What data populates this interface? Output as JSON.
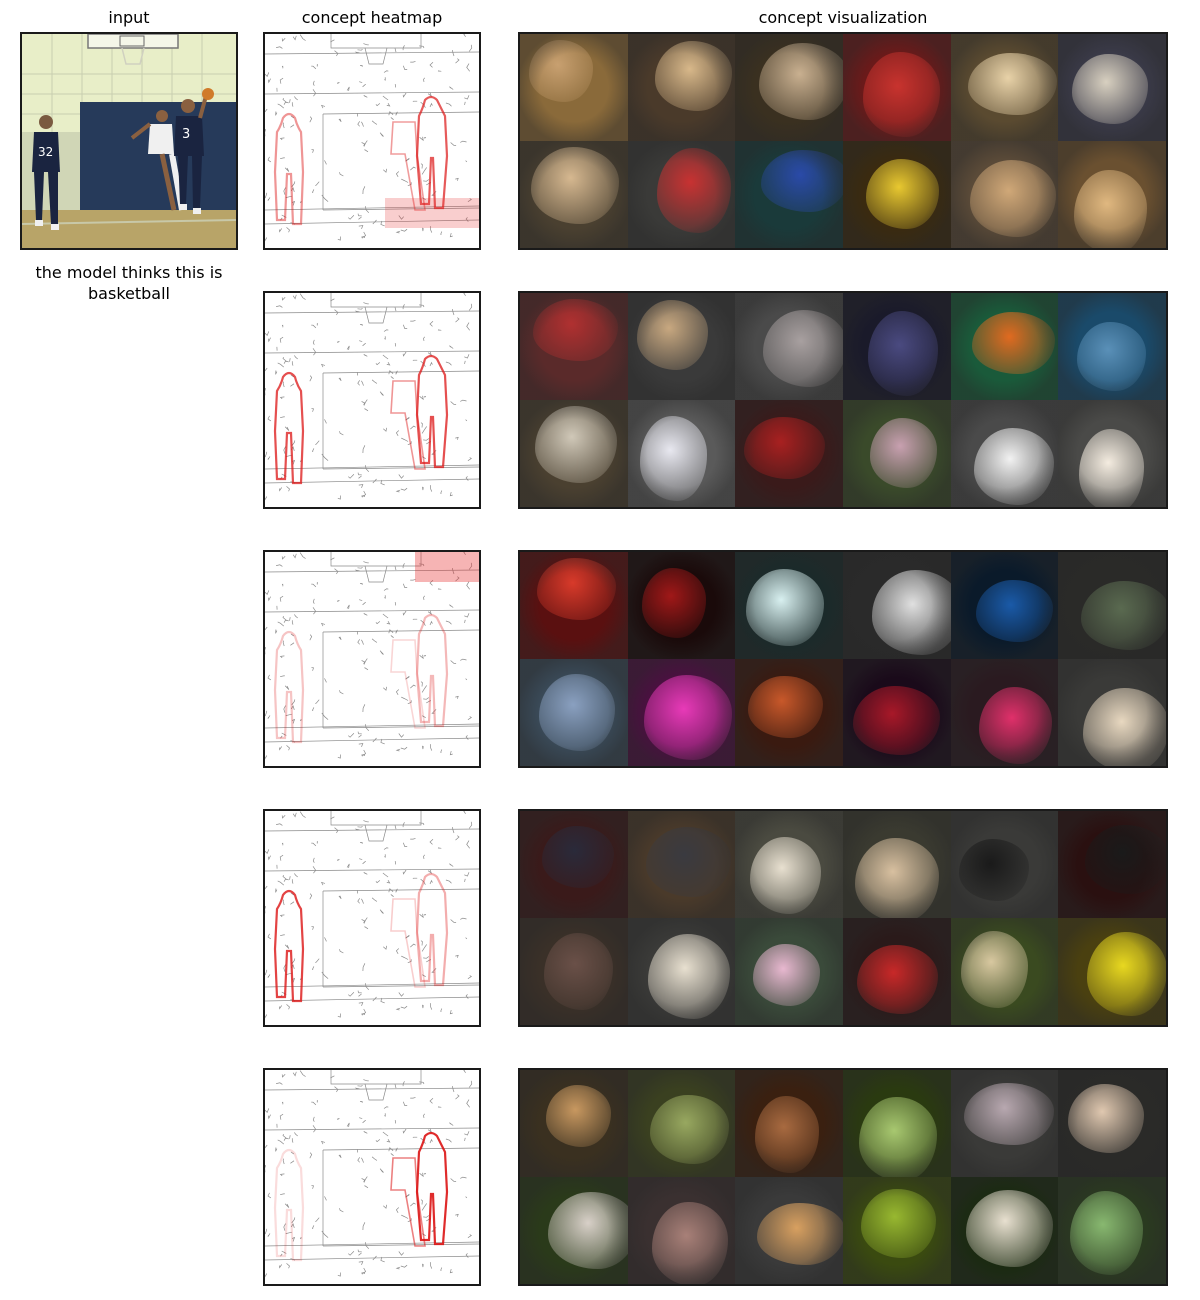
{
  "headers": {
    "input": "input",
    "heatmap": "concept heatmap",
    "visualization": "concept visualization"
  },
  "caption": "the model thinks this is basketball",
  "input_image": {
    "jersey_numbers": [
      "32",
      "3"
    ]
  },
  "concepts": [
    {
      "heatmap_focus": "both players and floor edge",
      "tiles": [
        {
          "bg": "#8a6a3a",
          "fg": "#c8a070"
        },
        {
          "bg": "#4a3a2a",
          "fg": "#d8b88a"
        },
        {
          "bg": "#3a3020",
          "fg": "#c9b090"
        },
        {
          "bg": "#6a1a1a",
          "fg": "#c8332e"
        },
        {
          "bg": "#5a4a30",
          "fg": "#e8d2a8"
        },
        {
          "bg": "#3a3a48",
          "fg": "#d8d0c0"
        },
        {
          "bg": "#4a4030",
          "fg": "#d6b890"
        },
        {
          "bg": "#3a3a38",
          "fg": "#c83232"
        },
        {
          "bg": "#1a3a3a",
          "fg": "#2a4aa8"
        },
        {
          "bg": "#3a2a10",
          "fg": "#e8c830"
        },
        {
          "bg": "#5a4a38",
          "fg": "#d0a878"
        },
        {
          "bg": "#6a5030",
          "fg": "#e0b880"
        }
      ]
    },
    {
      "heatmap_focus": "left player and right player",
      "tiles": [
        {
          "bg": "#5a2a2a",
          "fg": "#b03030"
        },
        {
          "bg": "#3a3a3a",
          "fg": "#c8a880"
        },
        {
          "bg": "#4a4a4a",
          "fg": "#a8a0a0"
        },
        {
          "bg": "#1a1a2a",
          "fg": "#4a4a80"
        },
        {
          "bg": "#1a5a3a",
          "fg": "#e06a20"
        },
        {
          "bg": "#1a4a6a",
          "fg": "#5a90b8"
        },
        {
          "bg": "#4a4030",
          "fg": "#d0c8b8"
        },
        {
          "bg": "#5a5a5a",
          "fg": "#e8e8f0"
        },
        {
          "bg": "#3a1a1a",
          "fg": "#a82020"
        },
        {
          "bg": "#3a4a2a",
          "fg": "#c8a0b0"
        },
        {
          "bg": "#4a4a4a",
          "fg": "#f2f2f2"
        },
        {
          "bg": "#4a4a48",
          "fg": "#f4ece0"
        }
      ]
    },
    {
      "heatmap_focus": "top-right corner",
      "tiles": [
        {
          "bg": "#5a1010",
          "fg": "#d83a2a"
        },
        {
          "bg": "#1a0a0a",
          "fg": "#a01818"
        },
        {
          "bg": "#1a2a2a",
          "fg": "#d8f0f0"
        },
        {
          "bg": "#2a2a2a",
          "fg": "#e0e0e0"
        },
        {
          "bg": "#0a1a2a",
          "fg": "#1a5aa8"
        },
        {
          "bg": "#2a2a28",
          "fg": "#5a6a50"
        },
        {
          "bg": "#3a4a58",
          "fg": "#8aa0c0"
        },
        {
          "bg": "#4a1040",
          "fg": "#e83ab8"
        },
        {
          "bg": "#3a1a10",
          "fg": "#c8582a"
        },
        {
          "bg": "#1a0a1a",
          "fg": "#a81828"
        },
        {
          "bg": "#2a1a20",
          "fg": "#e0306a"
        },
        {
          "bg": "#3a3a38",
          "fg": "#e8d8c0"
        }
      ]
    },
    {
      "heatmap_focus": "left player head",
      "tiles": [
        {
          "bg": "#3a1a1a",
          "fg": "#2a2a3a"
        },
        {
          "bg": "#4a3a2a",
          "fg": "#3a3a40"
        },
        {
          "bg": "#4a4a40",
          "fg": "#e8e0d0"
        },
        {
          "bg": "#3a3a30",
          "fg": "#d8c0a0"
        },
        {
          "bg": "#3a3a38",
          "fg": "#1a1a1a"
        },
        {
          "bg": "#2a1010",
          "fg": "#1a1a1a"
        },
        {
          "bg": "#3a3028",
          "fg": "#6a5048"
        },
        {
          "bg": "#3a3a38",
          "fg": "#e8e0d0"
        },
        {
          "bg": "#3a4a3a",
          "fg": "#e8b8d0"
        },
        {
          "bg": "#2a1a1a",
          "fg": "#c82828"
        },
        {
          "bg": "#3a4a20",
          "fg": "#d8c8a0"
        },
        {
          "bg": "#4a4010",
          "fg": "#e8d820"
        }
      ]
    },
    {
      "heatmap_focus": "right player",
      "tiles": [
        {
          "bg": "#3a3020",
          "fg": "#c89860"
        },
        {
          "bg": "#3a4020",
          "fg": "#98a860"
        },
        {
          "bg": "#3a2010",
          "fg": "#a86a40"
        },
        {
          "bg": "#2a3a10",
          "fg": "#a8c870"
        },
        {
          "bg": "#3a3a38",
          "fg": "#b8a8b0"
        },
        {
          "bg": "#2a2a28",
          "fg": "#e0c8b0"
        },
        {
          "bg": "#2a3a1a",
          "fg": "#d8d0c8"
        },
        {
          "bg": "#3a3030",
          "fg": "#a88078"
        },
        {
          "bg": "#3a3a3a",
          "fg": "#d8a060"
        },
        {
          "bg": "#3a4a10",
          "fg": "#98b830"
        },
        {
          "bg": "#1a2a10",
          "fg": "#e8e0d0"
        },
        {
          "bg": "#2a3a20",
          "fg": "#88b870"
        }
      ]
    }
  ]
}
